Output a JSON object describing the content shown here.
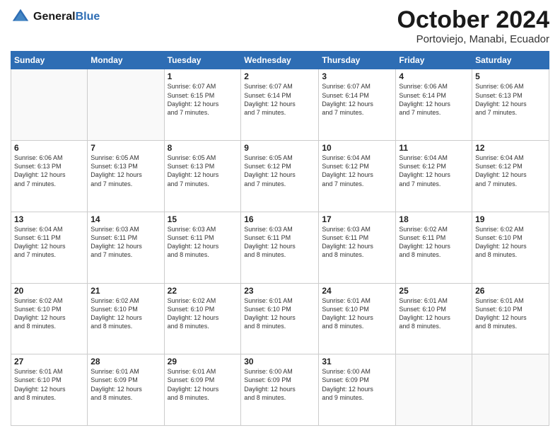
{
  "header": {
    "logo_general": "General",
    "logo_blue": "Blue",
    "month_title": "October 2024",
    "subtitle": "Portoviejo, Manabi, Ecuador"
  },
  "days_of_week": [
    "Sunday",
    "Monday",
    "Tuesday",
    "Wednesday",
    "Thursday",
    "Friday",
    "Saturday"
  ],
  "weeks": [
    [
      {
        "day": "",
        "info": ""
      },
      {
        "day": "",
        "info": ""
      },
      {
        "day": "1",
        "info": "Sunrise: 6:07 AM\nSunset: 6:15 PM\nDaylight: 12 hours\nand 7 minutes."
      },
      {
        "day": "2",
        "info": "Sunrise: 6:07 AM\nSunset: 6:14 PM\nDaylight: 12 hours\nand 7 minutes."
      },
      {
        "day": "3",
        "info": "Sunrise: 6:07 AM\nSunset: 6:14 PM\nDaylight: 12 hours\nand 7 minutes."
      },
      {
        "day": "4",
        "info": "Sunrise: 6:06 AM\nSunset: 6:14 PM\nDaylight: 12 hours\nand 7 minutes."
      },
      {
        "day": "5",
        "info": "Sunrise: 6:06 AM\nSunset: 6:13 PM\nDaylight: 12 hours\nand 7 minutes."
      }
    ],
    [
      {
        "day": "6",
        "info": "Sunrise: 6:06 AM\nSunset: 6:13 PM\nDaylight: 12 hours\nand 7 minutes."
      },
      {
        "day": "7",
        "info": "Sunrise: 6:05 AM\nSunset: 6:13 PM\nDaylight: 12 hours\nand 7 minutes."
      },
      {
        "day": "8",
        "info": "Sunrise: 6:05 AM\nSunset: 6:13 PM\nDaylight: 12 hours\nand 7 minutes."
      },
      {
        "day": "9",
        "info": "Sunrise: 6:05 AM\nSunset: 6:12 PM\nDaylight: 12 hours\nand 7 minutes."
      },
      {
        "day": "10",
        "info": "Sunrise: 6:04 AM\nSunset: 6:12 PM\nDaylight: 12 hours\nand 7 minutes."
      },
      {
        "day": "11",
        "info": "Sunrise: 6:04 AM\nSunset: 6:12 PM\nDaylight: 12 hours\nand 7 minutes."
      },
      {
        "day": "12",
        "info": "Sunrise: 6:04 AM\nSunset: 6:12 PM\nDaylight: 12 hours\nand 7 minutes."
      }
    ],
    [
      {
        "day": "13",
        "info": "Sunrise: 6:04 AM\nSunset: 6:11 PM\nDaylight: 12 hours\nand 7 minutes."
      },
      {
        "day": "14",
        "info": "Sunrise: 6:03 AM\nSunset: 6:11 PM\nDaylight: 12 hours\nand 7 minutes."
      },
      {
        "day": "15",
        "info": "Sunrise: 6:03 AM\nSunset: 6:11 PM\nDaylight: 12 hours\nand 8 minutes."
      },
      {
        "day": "16",
        "info": "Sunrise: 6:03 AM\nSunset: 6:11 PM\nDaylight: 12 hours\nand 8 minutes."
      },
      {
        "day": "17",
        "info": "Sunrise: 6:03 AM\nSunset: 6:11 PM\nDaylight: 12 hours\nand 8 minutes."
      },
      {
        "day": "18",
        "info": "Sunrise: 6:02 AM\nSunset: 6:11 PM\nDaylight: 12 hours\nand 8 minutes."
      },
      {
        "day": "19",
        "info": "Sunrise: 6:02 AM\nSunset: 6:10 PM\nDaylight: 12 hours\nand 8 minutes."
      }
    ],
    [
      {
        "day": "20",
        "info": "Sunrise: 6:02 AM\nSunset: 6:10 PM\nDaylight: 12 hours\nand 8 minutes."
      },
      {
        "day": "21",
        "info": "Sunrise: 6:02 AM\nSunset: 6:10 PM\nDaylight: 12 hours\nand 8 minutes."
      },
      {
        "day": "22",
        "info": "Sunrise: 6:02 AM\nSunset: 6:10 PM\nDaylight: 12 hours\nand 8 minutes."
      },
      {
        "day": "23",
        "info": "Sunrise: 6:01 AM\nSunset: 6:10 PM\nDaylight: 12 hours\nand 8 minutes."
      },
      {
        "day": "24",
        "info": "Sunrise: 6:01 AM\nSunset: 6:10 PM\nDaylight: 12 hours\nand 8 minutes."
      },
      {
        "day": "25",
        "info": "Sunrise: 6:01 AM\nSunset: 6:10 PM\nDaylight: 12 hours\nand 8 minutes."
      },
      {
        "day": "26",
        "info": "Sunrise: 6:01 AM\nSunset: 6:10 PM\nDaylight: 12 hours\nand 8 minutes."
      }
    ],
    [
      {
        "day": "27",
        "info": "Sunrise: 6:01 AM\nSunset: 6:10 PM\nDaylight: 12 hours\nand 8 minutes."
      },
      {
        "day": "28",
        "info": "Sunrise: 6:01 AM\nSunset: 6:09 PM\nDaylight: 12 hours\nand 8 minutes."
      },
      {
        "day": "29",
        "info": "Sunrise: 6:01 AM\nSunset: 6:09 PM\nDaylight: 12 hours\nand 8 minutes."
      },
      {
        "day": "30",
        "info": "Sunrise: 6:00 AM\nSunset: 6:09 PM\nDaylight: 12 hours\nand 8 minutes."
      },
      {
        "day": "31",
        "info": "Sunrise: 6:00 AM\nSunset: 6:09 PM\nDaylight: 12 hours\nand 9 minutes."
      },
      {
        "day": "",
        "info": ""
      },
      {
        "day": "",
        "info": ""
      }
    ]
  ]
}
